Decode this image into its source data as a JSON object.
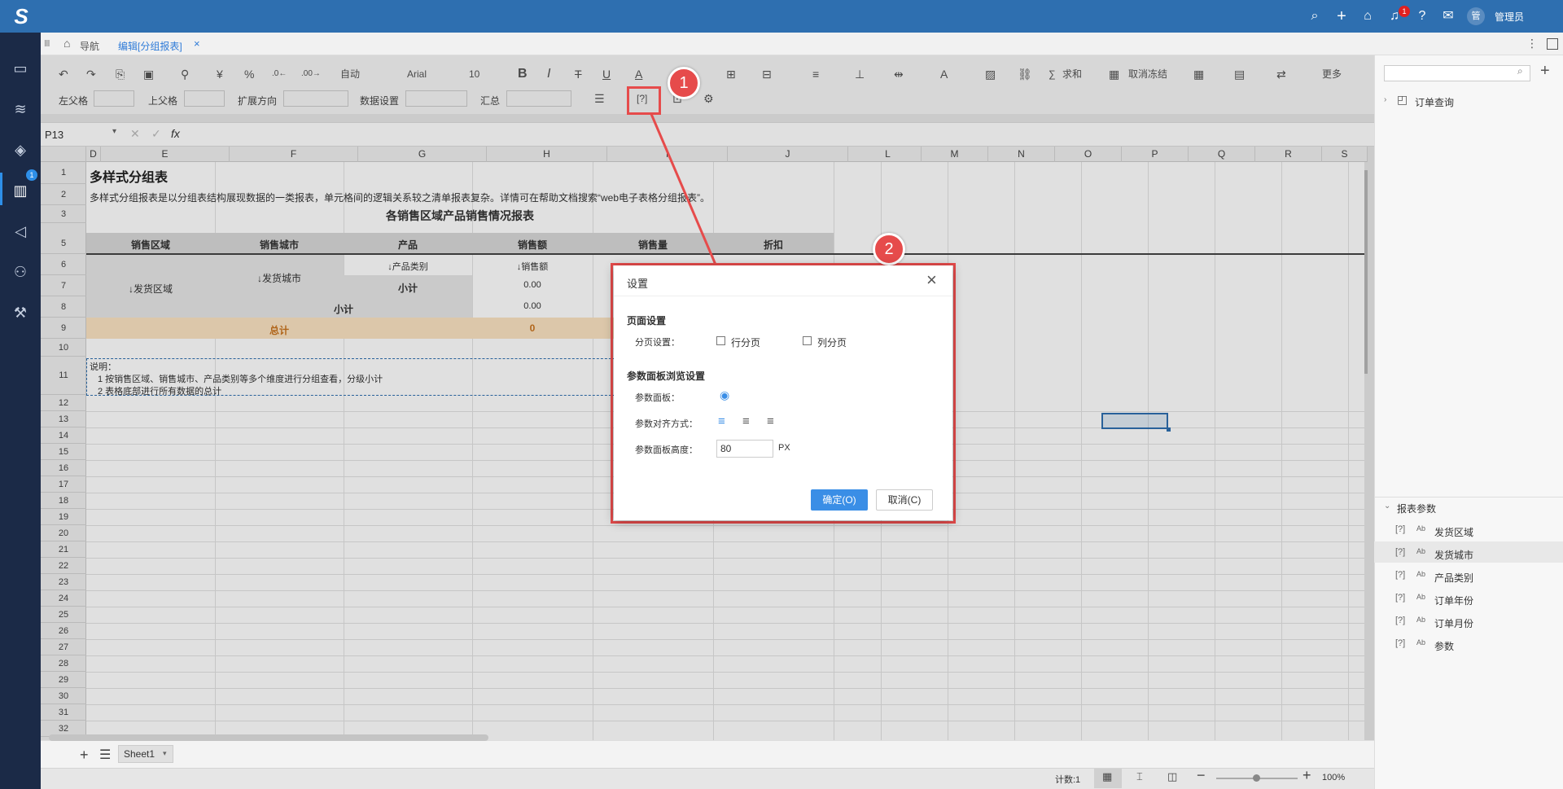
{
  "topbar": {
    "logo": "S",
    "icons": [
      "search-icon",
      "plus-icon",
      "home-icon",
      "bell-icon",
      "help-icon",
      "chat-icon"
    ],
    "notif_count": "1",
    "avatar": "管",
    "user": "管理员"
  },
  "sidebar": {
    "badge": "1",
    "icons": [
      "monitor-icon",
      "database-icon",
      "cube-icon",
      "chart-icon",
      "send-icon",
      "user-settings-icon",
      "tools-icon"
    ]
  },
  "tabs": {
    "home": "导航",
    "active": "编辑[分组报表]",
    "close": "×"
  },
  "toolbar": {
    "font_mode": "自动",
    "font": "Arial",
    "font_size": "10",
    "sum": "求和",
    "freeze": "取消冻结",
    "more": "更多",
    "param_btn": "[?]",
    "row2": {
      "left_parent": "左父格",
      "up_parent": "上父格",
      "expand": "扩展方向",
      "data_setting": "数据设置",
      "aggregate": "汇总"
    }
  },
  "formula": {
    "cell_ref": "P13",
    "fx": "fx"
  },
  "columns": [
    "D",
    "E",
    "F",
    "G",
    "H",
    "I",
    "J",
    "L",
    "M",
    "N",
    "O",
    "P",
    "Q",
    "R",
    "S"
  ],
  "rows": [
    "1",
    "2",
    "3",
    "5",
    "6",
    "7",
    "8",
    "9",
    "10",
    "11",
    "12",
    "13",
    "14",
    "15",
    "16",
    "17",
    "18",
    "19",
    "20",
    "21",
    "22",
    "23",
    "24",
    "25",
    "26",
    "27",
    "28",
    "29",
    "30",
    "31",
    "32"
  ],
  "report": {
    "title": "多样式分组表",
    "desc": "多样式分组报表是以分组表结构展现数据的一类报表，单元格间的逻辑关系较之清单报表复杂。详情可在帮助文档搜索“web电子表格分组报表”。",
    "subtitle": "各销售区域产品销售情况报表",
    "headers": [
      "销售区域",
      "销售城市",
      "产品",
      "销售额",
      "销售量",
      "折扣"
    ],
    "region": "↓发货区域",
    "city": "↓发货城市",
    "category": "↓产品类别",
    "amount": "↓销售额",
    "subtotal_small": "小计",
    "zero1": "0.00",
    "subtotal": "小计",
    "zero2": "0.00",
    "total": "总计",
    "total_val": "0",
    "notes": [
      "说明：",
      "1  按销售区域、销售城市、产品类别等多个维度进行分组查看，分级小计",
      "2  表格底部进行所有数据的总计"
    ]
  },
  "dialog": {
    "title": "设置",
    "close": "×",
    "page_section": "页面设置",
    "paging_label": "分页设置：",
    "row_paging": "行分页",
    "col_paging": "列分页",
    "param_section": "参数面板浏览设置",
    "panel_label": "参数面板：",
    "align_label": "参数对齐方式：",
    "height_label": "参数面板高度：",
    "height_value": "80",
    "unit": "PX",
    "ok": "确定(O)",
    "cancel": "取消(C)"
  },
  "annotations": {
    "one": "1",
    "two": "2"
  },
  "rightpanel": {
    "search_placeholder": "",
    "tree_item": "订单查询",
    "params_title": "报表参数",
    "params": [
      "发货区域",
      "发货城市",
      "产品类别",
      "订单年份",
      "订单月份",
      "参数"
    ],
    "param_prefix": "[?]",
    "param_type": "Ab"
  },
  "bottom": {
    "sheet": "Sheet1"
  },
  "status": {
    "count": "计数:1",
    "zoom": "100%"
  },
  "colors": {
    "topbar": "#2e6fb0",
    "sidebar": "#1b2a47",
    "accent": "#3a8ee6",
    "annotation": "#e64b4b",
    "header_fill": "#d9d9d9",
    "total_fill": "#fbe3c2",
    "total_text": "#c9731e"
  }
}
